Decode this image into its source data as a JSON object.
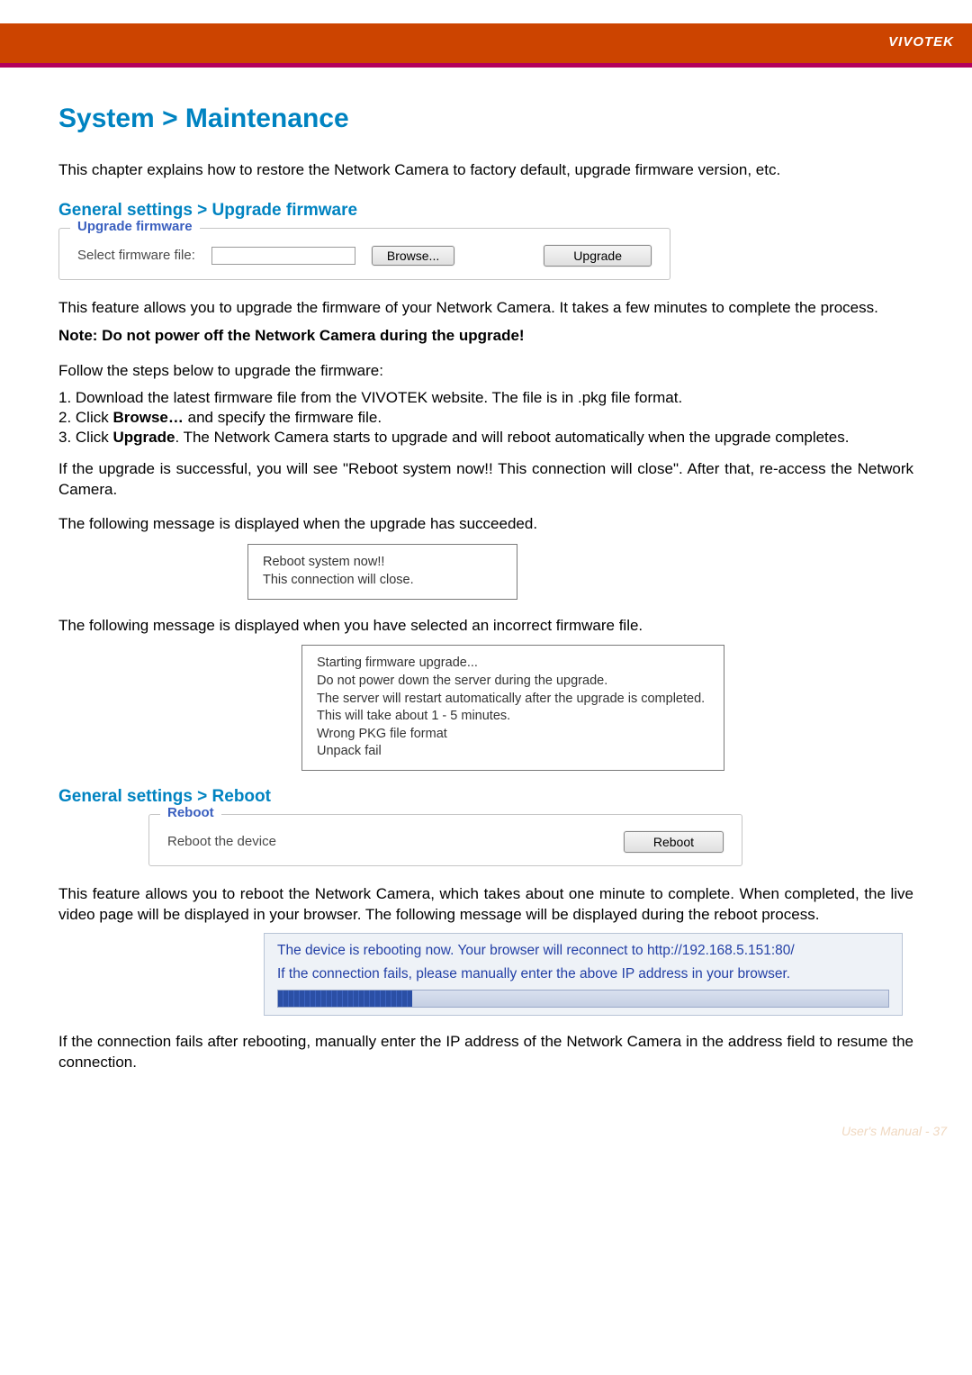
{
  "brand": "VIVOTEK",
  "title": "System > Maintenance",
  "intro": "This chapter explains how to restore the Network Camera to factory default, upgrade firmware version, etc.",
  "upgrade": {
    "section_heading": "General settings > Upgrade firmware",
    "legend": "Upgrade firmware",
    "file_label": "Select firmware file:",
    "browse_btn": "Browse...",
    "upgrade_btn": "Upgrade",
    "desc1": "This feature allows you to upgrade the firmware of your Network Camera. It takes a few minutes to complete the process.",
    "note": "Note: Do not power off the Network Camera during the upgrade!",
    "steps_intro": "Follow the steps below to upgrade the firmware:",
    "step1": "1. Download the latest firmware file from the VIVOTEK website. The file is in .pkg file format.",
    "step2_a": "2. Click ",
    "step2_b": "Browse…",
    "step2_c": " and specify the firmware file.",
    "step3_a": "3. Click ",
    "step3_b": "Upgrade",
    "step3_c": ". The Network Camera starts to upgrade and will reboot automatically when the upgrade completes.",
    "success_para": "If the upgrade is successful, you will see \"Reboot system now!! This connection will close\". After that, re-access the Network Camera.",
    "msg_succeed_intro": "The following message is displayed when the upgrade has succeeded.",
    "msg_succeed_l1": "Reboot system now!!",
    "msg_succeed_l2": "This connection will close.",
    "msg_fail_intro": "The following message is displayed when you have selected an incorrect firmware file.",
    "msg_fail_l1": "Starting firmware upgrade...",
    "msg_fail_l2": "Do not power down the server during the upgrade.",
    "msg_fail_l3": "The server will restart automatically after the upgrade is completed.",
    "msg_fail_l4": "This will take about 1 - 5 minutes.",
    "msg_fail_l5": "Wrong PKG file format",
    "msg_fail_l6": "Unpack fail"
  },
  "reboot": {
    "section_heading": "General settings > Reboot",
    "legend": "Reboot",
    "label": "Reboot the device",
    "btn": "Reboot",
    "desc": "This feature allows you to reboot the Network Camera, which takes about one minute to complete. When completed, the live video page will be displayed in your browser. The following message will be displayed during the reboot process.",
    "msg_l1": "The device is rebooting now. Your browser will reconnect to http://192.168.5.151:80/",
    "msg_l2": "If the connection fails, please manually enter the above IP address in your browser.",
    "after": "If the connection fails after rebooting, manually enter the IP address of the Network Camera in the address field to resume the connection."
  },
  "footer": "User's Manual - 37"
}
